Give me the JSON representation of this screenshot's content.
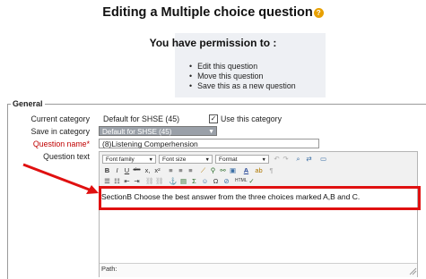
{
  "title": "Editing a Multiple choice question",
  "permissions": {
    "heading": "You have permission to :",
    "items": [
      "Edit this question",
      "Move this question",
      "Save this as a new question"
    ]
  },
  "form": {
    "legend": "General",
    "current_category": {
      "label": "Current category",
      "value": "Default for SHSE (45)",
      "checkbox_label": "Use this category",
      "checked": true
    },
    "save_in_category": {
      "label": "Save in category",
      "value": "Default for SHSE (45)"
    },
    "question_name": {
      "label": "Question name*",
      "value": "(8)Listening Comperhension"
    },
    "question_text": {
      "label": "Question text",
      "toolbar": {
        "font_family": "Font family",
        "font_size": "Font size",
        "format": "Format"
      },
      "content": "SectionB Choose the best answer from the three choices marked A,B and C.",
      "path_label": "Path:"
    }
  },
  "colors": {
    "label_required": "#c00000",
    "annotation": "#e01010",
    "help_icon": "#e8a000"
  }
}
